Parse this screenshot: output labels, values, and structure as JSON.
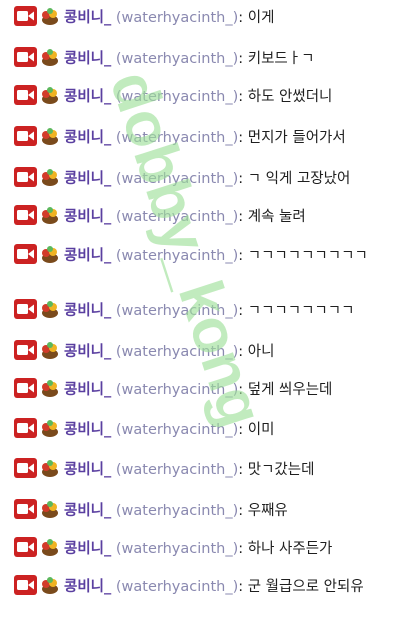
{
  "messages": [
    {
      "nickname": "콩비니_",
      "user_id": "(waterhyacinth_)",
      "colon": ":",
      "text": "이게"
    },
    {
      "nickname": "콩비니_",
      "user_id": "(waterhyacinth_)",
      "colon": ":",
      "text": "키보드ㅏㄱ"
    },
    {
      "nickname": "콩비니_",
      "user_id": "(waterhyacinth_)",
      "colon": ":",
      "text": "하도 안썼더니"
    },
    {
      "nickname": "콩비니_",
      "user_id": "(waterhyacinth_)",
      "colon": ":",
      "text": "먼지가 들어가서"
    },
    {
      "nickname": "콩비니_",
      "user_id": "(waterhyacinth_)",
      "colon": ":",
      "text": "ㄱ 익게 고장났어"
    },
    {
      "nickname": "콩비니_",
      "user_id": "(waterhyacinth_)",
      "colon": ":",
      "text": "계속 눌려"
    },
    {
      "nickname": "콩비니_",
      "user_id": "(waterhyacinth_)",
      "colon": ":",
      "text": "ㄱㄱㄱㄱㄱㄱㄱㄱㄱ"
    },
    {
      "nickname": "콩비니_",
      "user_id": "(waterhyacinth_)",
      "colon": ":",
      "text": "ㄱㄱㄱㄱㄱㄱㄱㄱ"
    },
    {
      "nickname": "콩비니_",
      "user_id": "(waterhyacinth_)",
      "colon": ":",
      "text": "아니"
    },
    {
      "nickname": "콩비니_",
      "user_id": "(waterhyacinth_)",
      "colon": ":",
      "text": "덮게 씌우는데"
    },
    {
      "nickname": "콩비니_",
      "user_id": "(waterhyacinth_)",
      "colon": ":",
      "text": "이미"
    },
    {
      "nickname": "콩비니_",
      "user_id": "(waterhyacinth_)",
      "colon": ":",
      "text": "맛ㄱ갔는데"
    },
    {
      "nickname": "콩비니_",
      "user_id": "(waterhyacinth_)",
      "colon": ":",
      "text": "우째유"
    },
    {
      "nickname": "콩비니_",
      "user_id": "(waterhyacinth_)",
      "colon": ":",
      "text": "하나 사주든가"
    },
    {
      "nickname": "콩비니_",
      "user_id": "(waterhyacinth_)",
      "colon": ":",
      "text": "군 월급으로 안되유"
    }
  ],
  "watermark": {
    "text": "dobby_kong",
    "color": "#9fe09a"
  },
  "colors": {
    "badge_red": "#cc2222",
    "nickname": "#5a3fa0",
    "user_id": "#8a89b0",
    "text": "#1f1f1f"
  },
  "icons": {
    "badge_1": "video-camera-icon",
    "badge_2": "fruit-bowl-icon"
  }
}
